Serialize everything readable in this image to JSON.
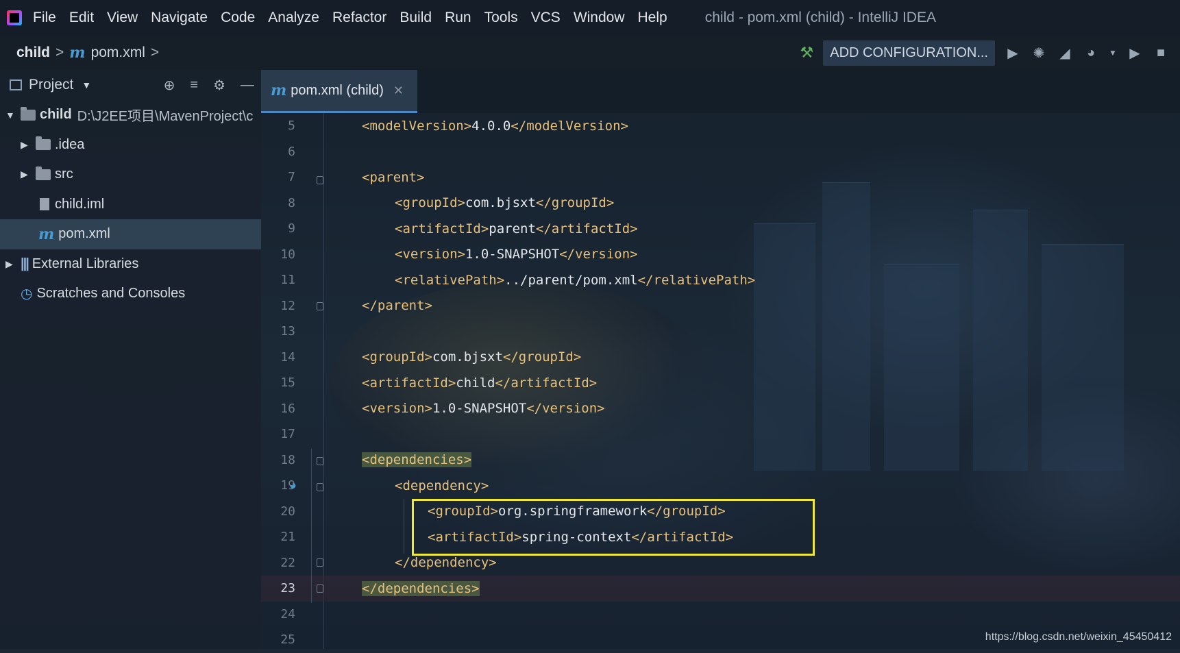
{
  "menubar": {
    "items": [
      "File",
      "Edit",
      "View",
      "Navigate",
      "Code",
      "Analyze",
      "Refactor",
      "Build",
      "Run",
      "Tools",
      "VCS",
      "Window",
      "Help"
    ],
    "window_title": "child - pom.xml (child) - IntelliJ IDEA"
  },
  "toolbar": {
    "breadcrumb_project": "child",
    "breadcrumb_file": "pom.xml",
    "config_label": "ADD CONFIGURATION..."
  },
  "project_panel": {
    "title": "Project",
    "tree": [
      {
        "label": "child",
        "path": "D:\\J2EE项目\\MavenProject\\c",
        "type": "module"
      },
      {
        "label": ".idea",
        "type": "folder"
      },
      {
        "label": "src",
        "type": "folder"
      },
      {
        "label": "child.iml",
        "type": "file"
      },
      {
        "label": "pom.xml",
        "type": "maven",
        "selected": true
      },
      {
        "label": "External Libraries",
        "type": "library"
      },
      {
        "label": "Scratches and Consoles",
        "type": "scratch"
      }
    ]
  },
  "editor": {
    "tab_label": "pom.xml (child)",
    "current_line": 23,
    "lines": [
      {
        "no": "5",
        "text": "<modelVersion>4.0.0</modelVersion>"
      },
      {
        "no": "6",
        "text": ""
      },
      {
        "no": "7",
        "text": "<parent>"
      },
      {
        "no": "8",
        "text": "<groupId>com.bjsxt</groupId>"
      },
      {
        "no": "9",
        "text": "<artifactId>parent</artifactId>"
      },
      {
        "no": "10",
        "text": "<version>1.0-SNAPSHOT</version>"
      },
      {
        "no": "11",
        "text": "<relativePath>../parent/pom.xml</relativePath>"
      },
      {
        "no": "12",
        "text": "</parent>"
      },
      {
        "no": "13",
        "text": ""
      },
      {
        "no": "14",
        "text": "<groupId>com.bjsxt</groupId>"
      },
      {
        "no": "15",
        "text": "<artifactId>child</artifactId>"
      },
      {
        "no": "16",
        "text": "<version>1.0-SNAPSHOT</version>"
      },
      {
        "no": "17",
        "text": ""
      },
      {
        "no": "18",
        "text": "<dependencies>"
      },
      {
        "no": "19",
        "text": "<dependency>"
      },
      {
        "no": "20",
        "text": "<groupId>org.springframework</groupId>"
      },
      {
        "no": "21",
        "text": "<artifactId>spring-context</artifactId>"
      },
      {
        "no": "22",
        "text": "</dependency>"
      },
      {
        "no": "23",
        "text": "</dependencies>"
      },
      {
        "no": "24",
        "text": ""
      },
      {
        "no": "25",
        "text": ""
      }
    ]
  },
  "watermark": "https://blog.csdn.net/weixin_45450412",
  "colors": {
    "tag": "#e8c17a",
    "highlight_box": "#f2e838",
    "accent": "#4a88c7"
  }
}
